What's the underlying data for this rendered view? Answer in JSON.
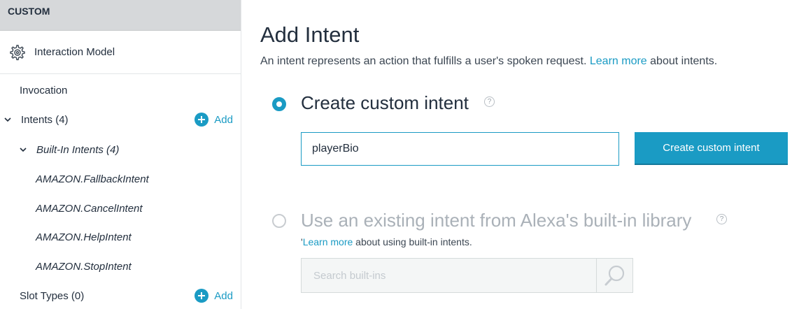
{
  "sidebar": {
    "header": "CUSTOM",
    "section": {
      "label": "Interaction Model",
      "icon": "gear-icon"
    },
    "invocation": "Invocation",
    "intents": {
      "label": "Intents (4)",
      "add_label": "Add"
    },
    "builtin": {
      "label": "Built-In Intents (4)",
      "items": [
        "AMAZON.FallbackIntent",
        "AMAZON.CancelIntent",
        "AMAZON.HelpIntent",
        "AMAZON.StopIntent"
      ]
    },
    "slot_types": {
      "label": "Slot Types (0)",
      "add_label": "Add"
    }
  },
  "main": {
    "title": "Add Intent",
    "description": {
      "before": "An intent represents an action that fulfills a user's spoken request. ",
      "link": "Learn more",
      "after": " about intents."
    },
    "custom_option": {
      "label": "Create custom intent",
      "help": "?",
      "input_value": "playerBio",
      "button_label": "Create custom intent",
      "selected": true
    },
    "builtin_option": {
      "label": "Use an existing intent from Alexa's built-in library",
      "help": "?",
      "desc_before": "'",
      "desc_link": "Learn more",
      "desc_after": " about using built-in intents.",
      "search_placeholder": "Search built-ins",
      "selected": false
    }
  },
  "colors": {
    "accent": "#1a9bc4",
    "sidebar_header_bg": "#d6d8da",
    "text": "#232f3e",
    "disabled_text": "#aab1b8"
  }
}
